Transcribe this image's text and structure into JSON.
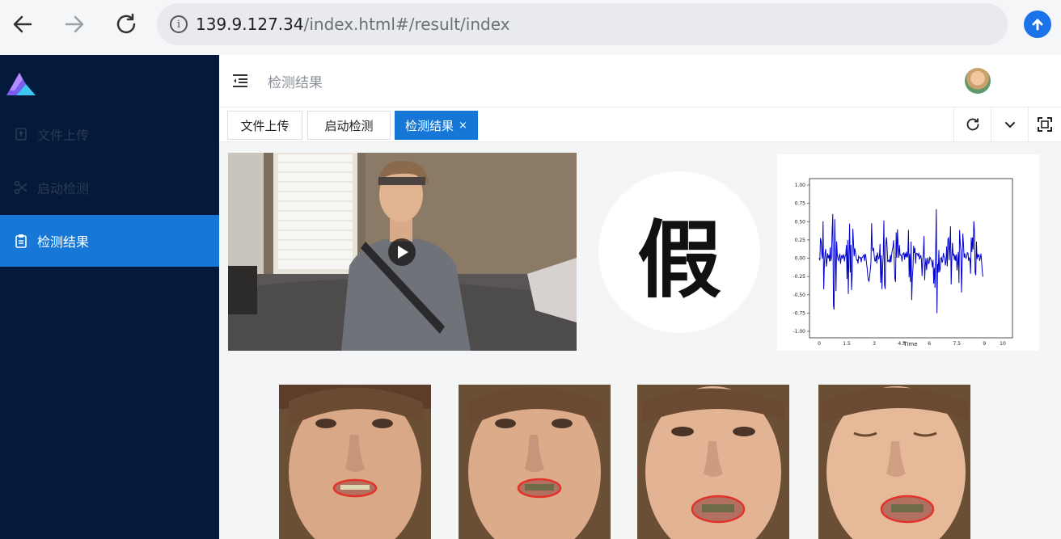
{
  "browser": {
    "url_host": "139.9.127.34",
    "url_path": "/index.html#/result/index",
    "back_icon": "arrow-left-icon",
    "forward_icon": "arrow-right-icon",
    "reload_icon": "reload-icon",
    "upload_icon": "arrow-up-circle-icon"
  },
  "sidebar": {
    "items": [
      {
        "label": "文件上传",
        "icon": "upload-file-icon",
        "active": false
      },
      {
        "label": "启动检测",
        "icon": "scissors-icon",
        "active": false
      },
      {
        "label": "检测结果",
        "icon": "clipboard-icon",
        "active": true
      }
    ]
  },
  "header": {
    "breadcrumb": "检测结果"
  },
  "tabs": [
    {
      "label": "文件上传",
      "active": false
    },
    {
      "label": "启动检测",
      "active": false
    },
    {
      "label": "检测结果",
      "active": true,
      "close": "×"
    }
  ],
  "result": {
    "verdict": "假"
  },
  "waveform": {
    "type": "line",
    "xlabel": "Time",
    "x_ticks": [
      "0",
      "1.5",
      "3",
      "4.5",
      "6",
      "7.5",
      "9",
      "10"
    ],
    "y_ticks": [
      "1.00",
      "0.75",
      "0.50",
      "0.25",
      "0.00",
      "-0.25",
      "-0.50",
      "-0.75",
      "-1.00"
    ],
    "xlim": [
      0,
      10
    ],
    "ylim": [
      -1,
      1
    ],
    "color": "#0000cc"
  },
  "colors": {
    "accent": "#1677d6",
    "sidebar_bg": "#041a3a",
    "lip_outline": "#e3322a"
  }
}
